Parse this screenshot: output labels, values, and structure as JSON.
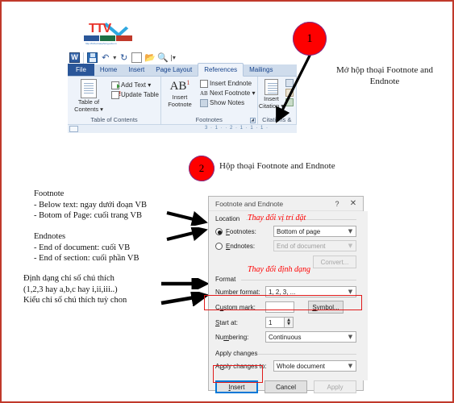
{
  "page": {
    "border_color": "#c0392b",
    "background": "#ffffff"
  },
  "logo": {
    "name": "TTV",
    "url_text": "http://tinhocvanphong.edu.vn",
    "bar_items": [
      "Word",
      "Excel",
      "PowerPoint"
    ],
    "check_color": "#2fa8e0",
    "text_color": "#e8332a"
  },
  "word_window": {
    "quick_access": [
      {
        "name": "word-icon",
        "glyph": "W"
      },
      {
        "name": "save-icon",
        "glyph": ""
      },
      {
        "name": "undo-icon",
        "glyph": "↶"
      },
      {
        "name": "undo-dropdown-icon",
        "glyph": "▾"
      },
      {
        "name": "redo-icon",
        "glyph": "↻"
      },
      {
        "name": "new-document-icon",
        "glyph": "⬜"
      },
      {
        "name": "open-folder-icon",
        "glyph": "📂"
      },
      {
        "name": "print-preview-icon",
        "glyph": "🔍"
      },
      {
        "name": "customize-qat-icon",
        "glyph": "▾"
      }
    ],
    "tabs": [
      {
        "label": "File",
        "state": "file"
      },
      {
        "label": "Home",
        "state": "normal"
      },
      {
        "label": "Insert",
        "state": "normal"
      },
      {
        "label": "Page Layout",
        "state": "normal"
      },
      {
        "label": "References",
        "state": "active"
      },
      {
        "label": "Mailings",
        "state": "normal"
      }
    ],
    "ribbon": {
      "group_toc": {
        "label": "Table of Contents",
        "big_button": "Table of\nContents",
        "big_button_line1": "Table of",
        "big_button_line2": "Contents ▾",
        "items": [
          "Add Text ▾",
          "Update Table"
        ]
      },
      "group_footnotes": {
        "label": "Footnotes",
        "big_button_line1": "Insert",
        "big_button_line2": "Footnote",
        "big_button_mark": "AB",
        "big_button_sup": "1",
        "items": [
          "Insert Endnote",
          "Next Footnote ▾",
          "Show Notes"
        ],
        "dialog_launcher": "⬎"
      },
      "group_citations": {
        "label": "Citations &",
        "big_button_line1": "Insert",
        "big_button_line2": "Citation ▾"
      }
    },
    "ruler": {
      "ticks": "3 · 1 · · 2 · 1 · 1 · 1 ·"
    }
  },
  "callouts": [
    {
      "number": "1",
      "text_line1": "Mở hộp thoại Footnote and",
      "text_line2": "Endnote"
    },
    {
      "number": "2",
      "text": "Hộp thoại Footnote and Endnote"
    }
  ],
  "annotations": {
    "footnote_block": [
      "Footnote",
      "- Below text: ngay dưới đoạn VB",
      "- Botom of Page: cuối trang VB"
    ],
    "endnote_block": [
      "Endnotes",
      "- End of document: cuối VB",
      "- End of section: cuối phần VB"
    ],
    "format_block": [
      "Định dạng chỉ số chú thích",
      "(1,2,3 hay a,b,c hay i,ii,iii..)",
      "Kiểu chỉ số chú thích tuỳ chon"
    ]
  },
  "dialog": {
    "title": "Footnote and Endnote",
    "help_button": "?",
    "close_button": "✕",
    "location": {
      "section_label": "Location",
      "footnotes_radio_label": "Footnotes:",
      "footnotes_value": "Bottom of page",
      "footnotes_selected": true,
      "endnotes_radio_label": "Endnotes:",
      "endnotes_value": "End of document",
      "endnotes_selected": false,
      "convert_button": "Convert...",
      "red_note": "Thay đổi vị trí đặt"
    },
    "format": {
      "section_label": "Format",
      "number_format_label": "Number format:",
      "number_format_value": "1, 2, 3, ...",
      "custom_mark_label": "Custom mark:",
      "custom_mark_value": "",
      "symbol_button": "Symbol...",
      "start_at_label": "Start at:",
      "start_at_value": "1",
      "numbering_label": "Numbering:",
      "numbering_value": "Continuous",
      "red_note": "Thay đổi định dạng"
    },
    "apply_changes": {
      "section_label": "Apply changes",
      "apply_to_label": "Apply changes to:",
      "apply_to_value": "Whole document"
    },
    "buttons": {
      "insert": "Insert",
      "cancel": "Cancel",
      "apply": "Apply"
    },
    "highlight_color": "#e01b1b",
    "focus_color": "#0078d7"
  }
}
